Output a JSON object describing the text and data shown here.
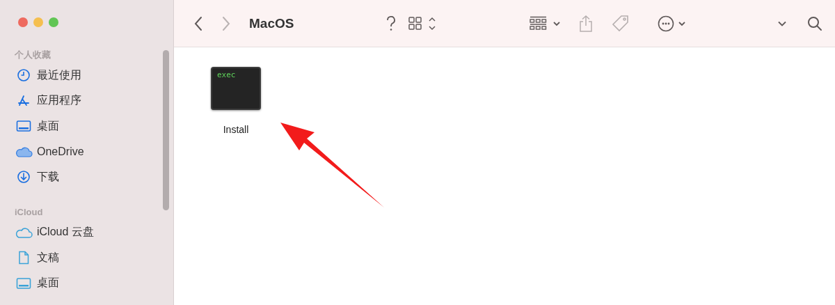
{
  "window": {
    "title": "MacOS"
  },
  "sidebar": {
    "sections": [
      {
        "title": "个人收藏",
        "items": [
          {
            "label": "最近使用",
            "kind": "clock"
          },
          {
            "label": "应用程序",
            "kind": "apps"
          },
          {
            "label": "桌面",
            "kind": "desktop"
          },
          {
            "label": "OneDrive",
            "kind": "cloud-filled"
          },
          {
            "label": "下载",
            "kind": "download"
          }
        ]
      },
      {
        "title": "iCloud",
        "items": [
          {
            "label": "iCloud 云盘",
            "kind": "cloud"
          },
          {
            "label": "文稿",
            "kind": "doc"
          },
          {
            "label": "桌面",
            "kind": "desktop-light"
          }
        ]
      }
    ]
  },
  "files": [
    {
      "name": "Install",
      "kind": "exec",
      "badge": "exec"
    }
  ],
  "annotation": {
    "kind": "arrow"
  }
}
